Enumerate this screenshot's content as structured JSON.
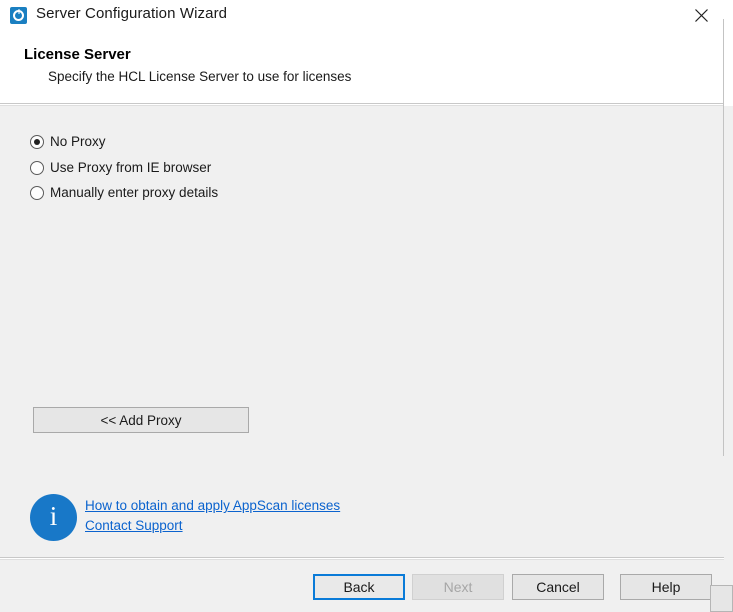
{
  "window": {
    "title": "Server Configuration Wizard",
    "icon": "appscan-logo-icon",
    "close_label": "✕"
  },
  "header": {
    "title": "License Server",
    "subtitle": "Specify the HCL License Server to use for licenses"
  },
  "proxy_options": [
    {
      "label": "No Proxy",
      "selected": true
    },
    {
      "label": "Use Proxy from IE browser",
      "selected": false
    },
    {
      "label": "Manually enter proxy details",
      "selected": false
    }
  ],
  "add_proxy_button": {
    "label": "<< Add Proxy",
    "enabled": true
  },
  "info": {
    "icon": "info-circle-icon",
    "glyph": "i",
    "links": [
      {
        "label": "How to obtain and apply AppScan licenses"
      },
      {
        "label": "Contact Support"
      }
    ]
  },
  "footer_buttons": [
    {
      "label": "Back",
      "state": "focused"
    },
    {
      "label": "Next",
      "state": "disabled"
    },
    {
      "label": "Cancel",
      "state": "normal"
    },
    {
      "label": "Help",
      "state": "normal"
    }
  ],
  "colors": {
    "title_icon_blue": "#1a7fc1",
    "info_blue": "#1878c8",
    "link_blue": "#0b63ce",
    "focus_blue": "#0a7bd8",
    "body_gray": "#f0f0f0",
    "button_face": "#e6e6e6",
    "disabled_text": "#a6a6a6"
  }
}
